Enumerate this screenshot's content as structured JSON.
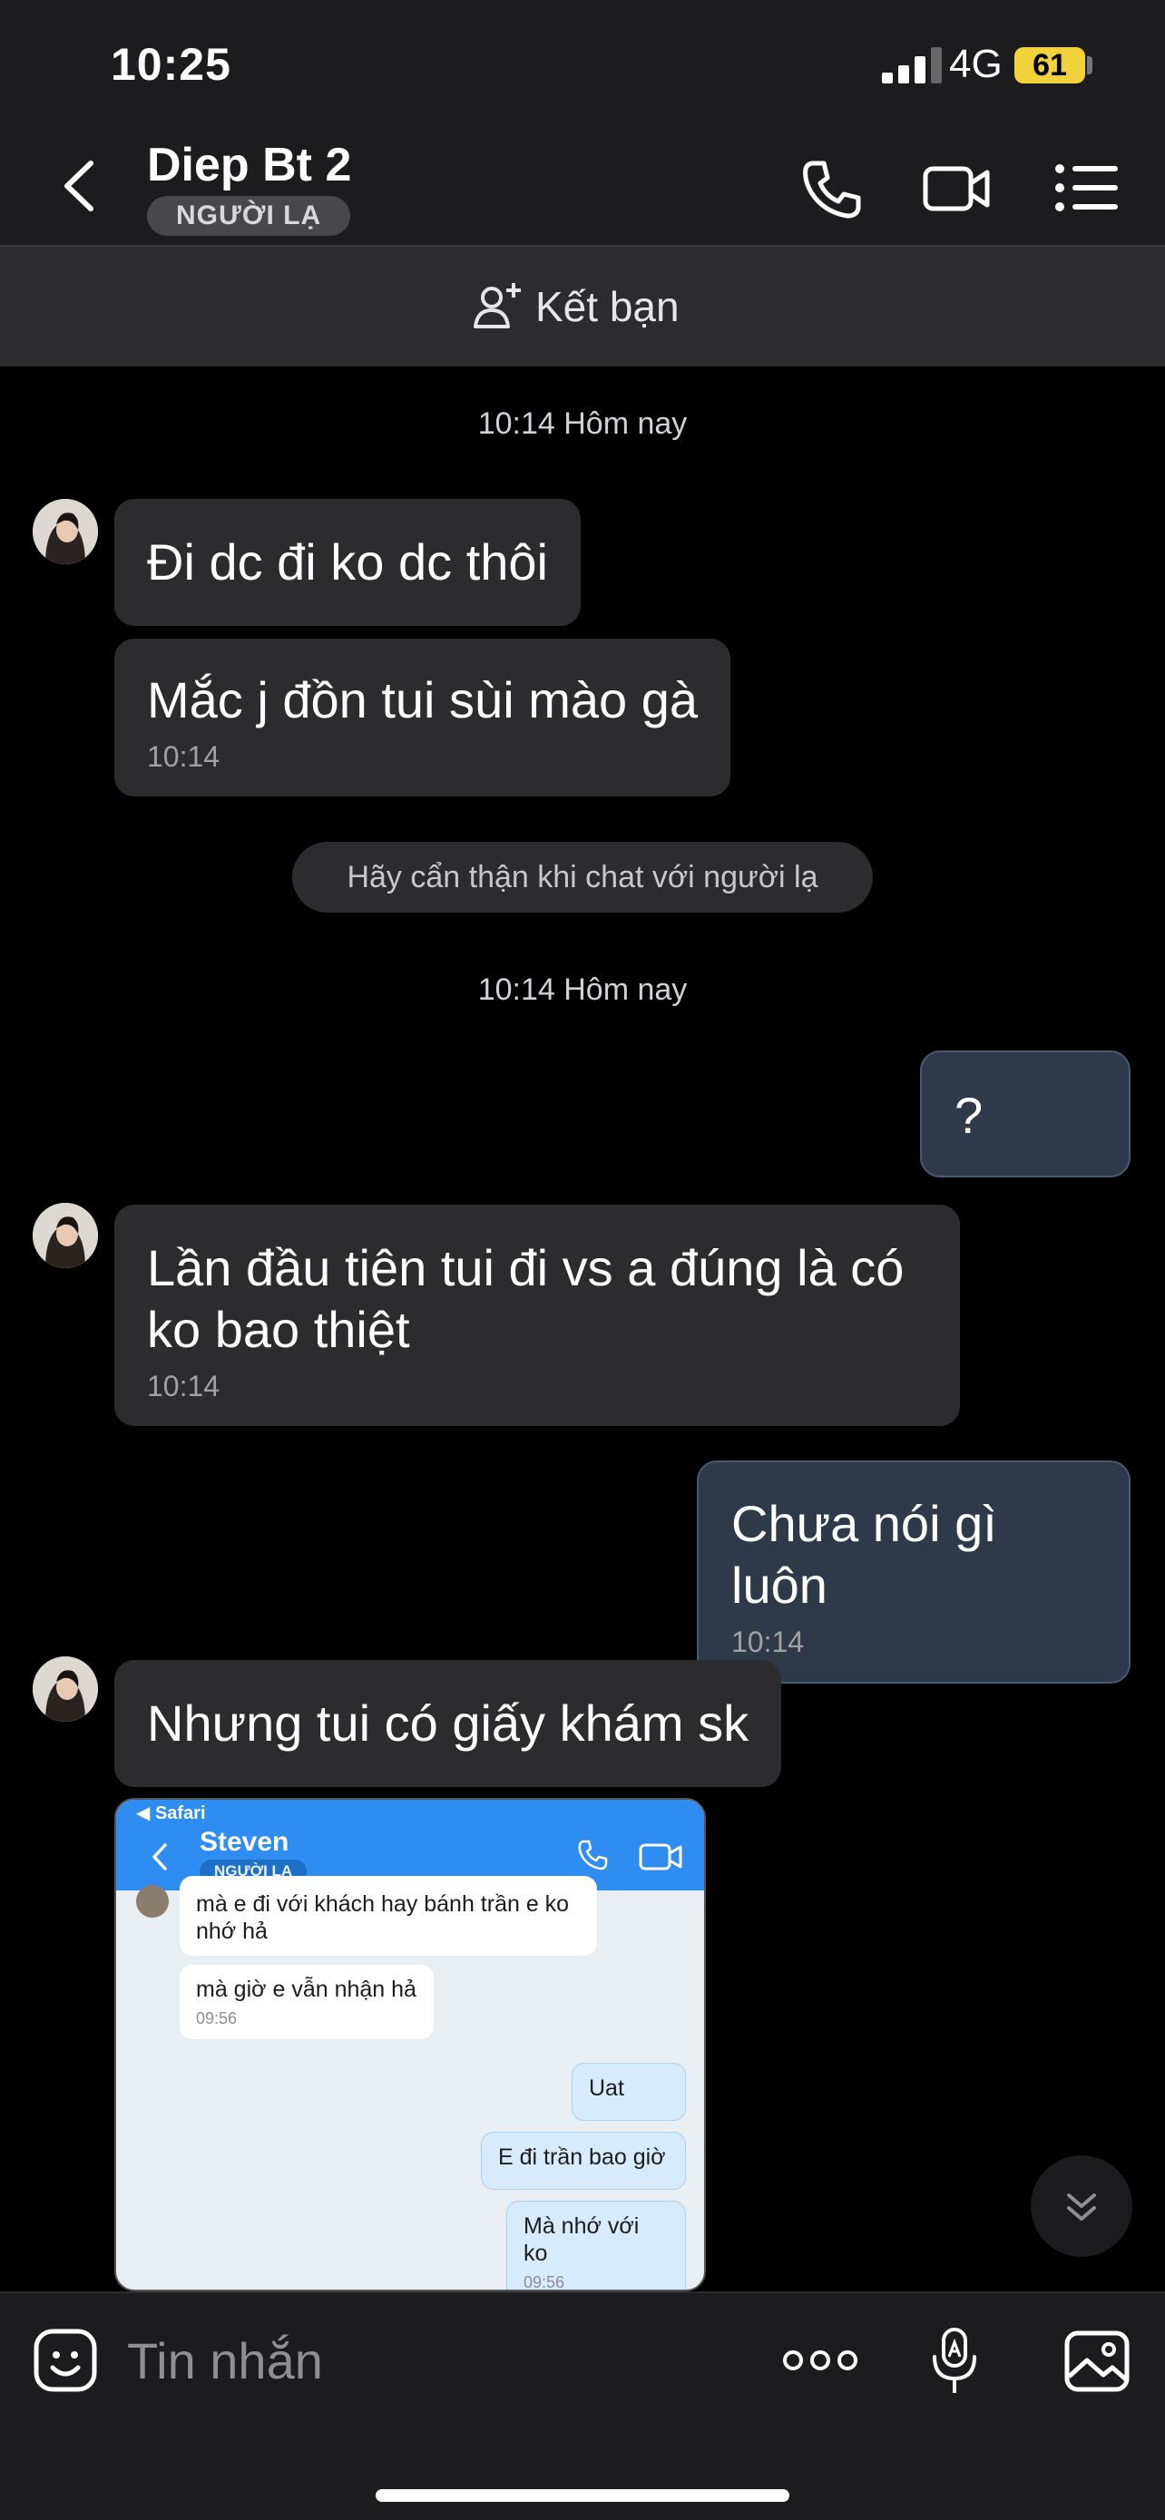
{
  "status": {
    "time": "10:25",
    "network": "4G",
    "battery": "61"
  },
  "header": {
    "title": "Diep Bt 2",
    "badge": "NGƯỜI LẠ"
  },
  "friend_bar": {
    "label": "Kết bạn"
  },
  "chat": {
    "sep1": "10:14 Hôm nay",
    "msg1": "Đi dc đi ko dc thôi",
    "msg2": "Mắc j đồn tui sùi mào gà",
    "msg2_time": "10:14",
    "notice": "Hãy cẩn thận khi chat với người lạ",
    "sep2": "10:14 Hôm nay",
    "msg3": "?",
    "msg4": "Lần đầu tiên tui đi vs a đúng là có ko bao thiệt",
    "msg4_time": "10:14",
    "msg5": "Chưa nói gì luôn",
    "msg5_time": "10:14",
    "msg6": "Nhưng tui có giấy khám sk"
  },
  "screenshot": {
    "safari": "◀ Safari",
    "name": "Steven",
    "badge": "NGƯỜI LẠ",
    "m1": "mà e đi với khách hay bánh trần e ko nhớ hả",
    "m2": "mà giờ e vẫn nhận hả",
    "m2_time": "09:56",
    "m3": "Uat",
    "m4": "E đi trần bao giờ",
    "m5": "Mà nhớ với ko",
    "m5_time": "09:56"
  },
  "input": {
    "placeholder": "Tin nhắn"
  }
}
